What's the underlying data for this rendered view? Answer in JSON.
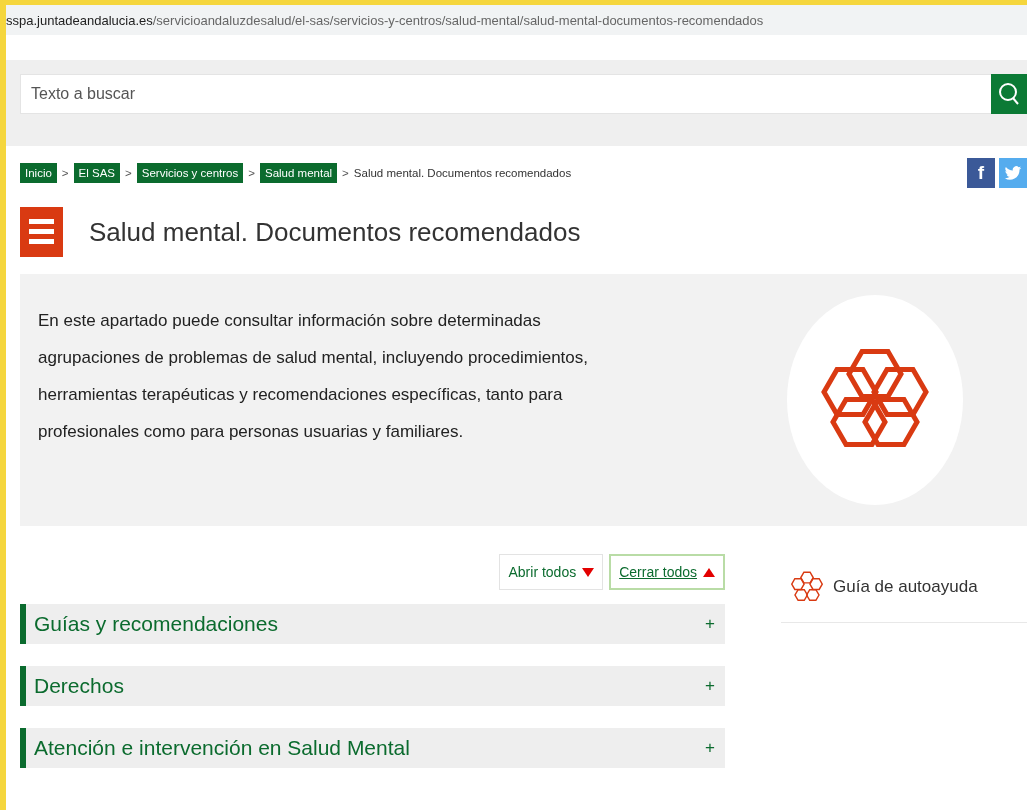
{
  "url": {
    "host": "sspa.juntadeandalucia.es",
    "path": "/servicioandaluzdesalud/el-sas/servicios-y-centros/salud-mental/salud-mental-documentos-recomendados"
  },
  "search": {
    "placeholder": "Texto a buscar"
  },
  "breadcrumb": [
    {
      "label": "Inicio",
      "current": false
    },
    {
      "label": "El SAS",
      "current": false,
      "separator": ">"
    },
    {
      "label": "Servicios y centros",
      "current": false,
      "separator": ">"
    },
    {
      "label": "Salud mental",
      "current": false,
      "separator": ">"
    },
    {
      "label": "Salud mental. Documentos recomendados",
      "current": true,
      "separator": ">"
    }
  ],
  "social": [
    {
      "kind": "facebook",
      "label": "f"
    },
    {
      "kind": "twitter"
    }
  ],
  "title": "Salud mental. Documentos recomendados",
  "intro": "En este apartado puede consultar información sobre determinadas agrupaciones de problemas de salud mental, incluyendo procedimientos, herramientas terapéuticas y recomendaciones específicas, tanto para profesionales como para personas usuarias y familiares.",
  "controls": [
    {
      "kind": "open",
      "label": "Abrir todos",
      "focused": false
    },
    {
      "kind": "close",
      "label": "Cerrar todos",
      "focused": true
    }
  ],
  "sections": [
    {
      "label": "Guías y recomendaciones",
      "expanded": false,
      "toggle": "+"
    },
    {
      "label": "Derechos",
      "expanded": false,
      "toggle": "+"
    },
    {
      "label": "Atención e intervención en Salud Mental",
      "expanded": false,
      "toggle": "+"
    }
  ],
  "sidebar": [
    {
      "label": "Guía de autoayuda"
    }
  ]
}
